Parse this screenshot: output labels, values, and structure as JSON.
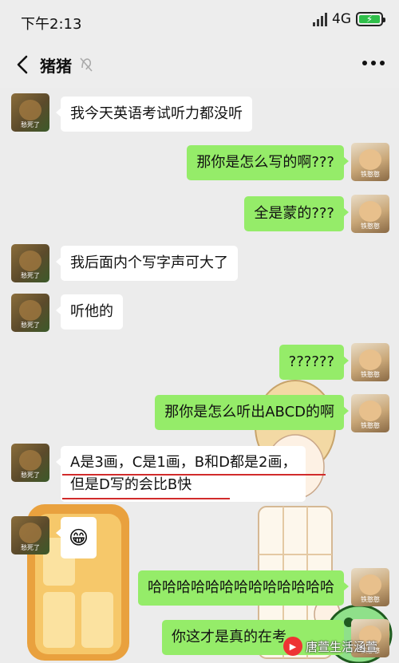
{
  "status": {
    "time": "下午2:13",
    "network": "4G"
  },
  "chat": {
    "title": "猪猪"
  },
  "avatars": {
    "friend_caption": "愁死了",
    "me_caption": "铁憨憨"
  },
  "messages": {
    "m1": "我今天英语考试听力都没听",
    "m2": "那你是怎么写的啊???",
    "m3": "全是蒙的???",
    "m4": "我后面内个写字声可大了",
    "m5": "听他的",
    "m6": "??????",
    "m7": "那你是怎么听出ABCD的啊",
    "m8_line1": "A是3画，C是1画，B和D都是2画，",
    "m8_line2": "但是D写的会比B快",
    "m9": "😁",
    "m10": "哈哈哈哈哈哈哈哈哈哈哈哈哈",
    "m11": "你这才是真的在考"
  },
  "watermark": {
    "text": "唐萱生活涵萱"
  },
  "colors": {
    "green_bubble": "#95ec69",
    "white_bubble": "#ffffff",
    "background": "#ececec",
    "underline": "#d12b2b"
  }
}
